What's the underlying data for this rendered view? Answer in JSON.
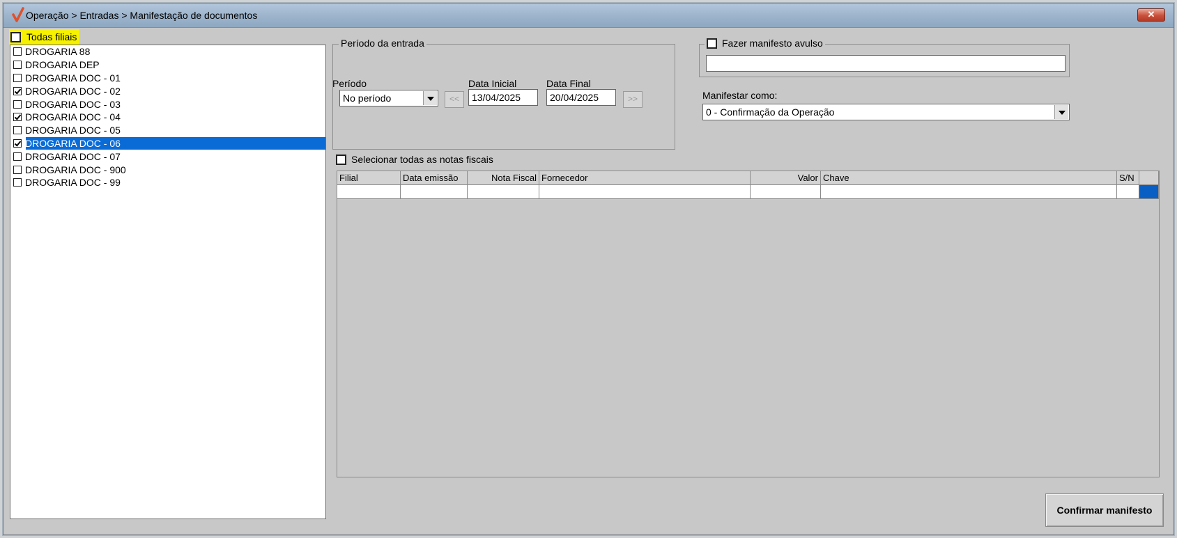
{
  "window": {
    "title": "Operação > Entradas > Manifestação de documentos",
    "close_label": "✕"
  },
  "branches": {
    "all_label": "Todas filiais",
    "all_checked": false,
    "items": [
      {
        "label": "DROGARIA 88",
        "checked": false,
        "selected": false
      },
      {
        "label": "DROGARIA DEP",
        "checked": false,
        "selected": false
      },
      {
        "label": "DROGARIA DOC - 01",
        "checked": false,
        "selected": false
      },
      {
        "label": "DROGARIA DOC - 02",
        "checked": true,
        "selected": false
      },
      {
        "label": "DROGARIA DOC - 03",
        "checked": false,
        "selected": false
      },
      {
        "label": "DROGARIA DOC - 04",
        "checked": true,
        "selected": false
      },
      {
        "label": "DROGARIA DOC - 05",
        "checked": false,
        "selected": false
      },
      {
        "label": "DROGARIA DOC - 06",
        "checked": true,
        "selected": true
      },
      {
        "label": "DROGARIA DOC - 07",
        "checked": false,
        "selected": false
      },
      {
        "label": "DROGARIA DOC - 900",
        "checked": false,
        "selected": false
      },
      {
        "label": "DROGARIA DOC - 99",
        "checked": false,
        "selected": false
      }
    ]
  },
  "period": {
    "group_label": "Período da entrada",
    "period_label": "Período",
    "period_value": "No período",
    "start_label": "Data Inicial",
    "start_value": "13/04/2025",
    "end_label": "Data Final",
    "end_value": "20/04/2025",
    "prev_label": "<<",
    "next_label": ">>"
  },
  "avulso": {
    "label": "Fazer manifesto avulso",
    "checked": false,
    "value": ""
  },
  "manifest_as": {
    "label": "Manifestar como:",
    "value": "0 - Confirmação da Operação"
  },
  "select_all_notes_label": "Selecionar todas as notas fiscais",
  "grid": {
    "columns": [
      "Filial",
      "Data emissão",
      "Nota Fiscal",
      "Fornecedor",
      "Valor",
      "Chave",
      "S/N"
    ]
  },
  "confirm_label": "Confirmar manifesto"
}
